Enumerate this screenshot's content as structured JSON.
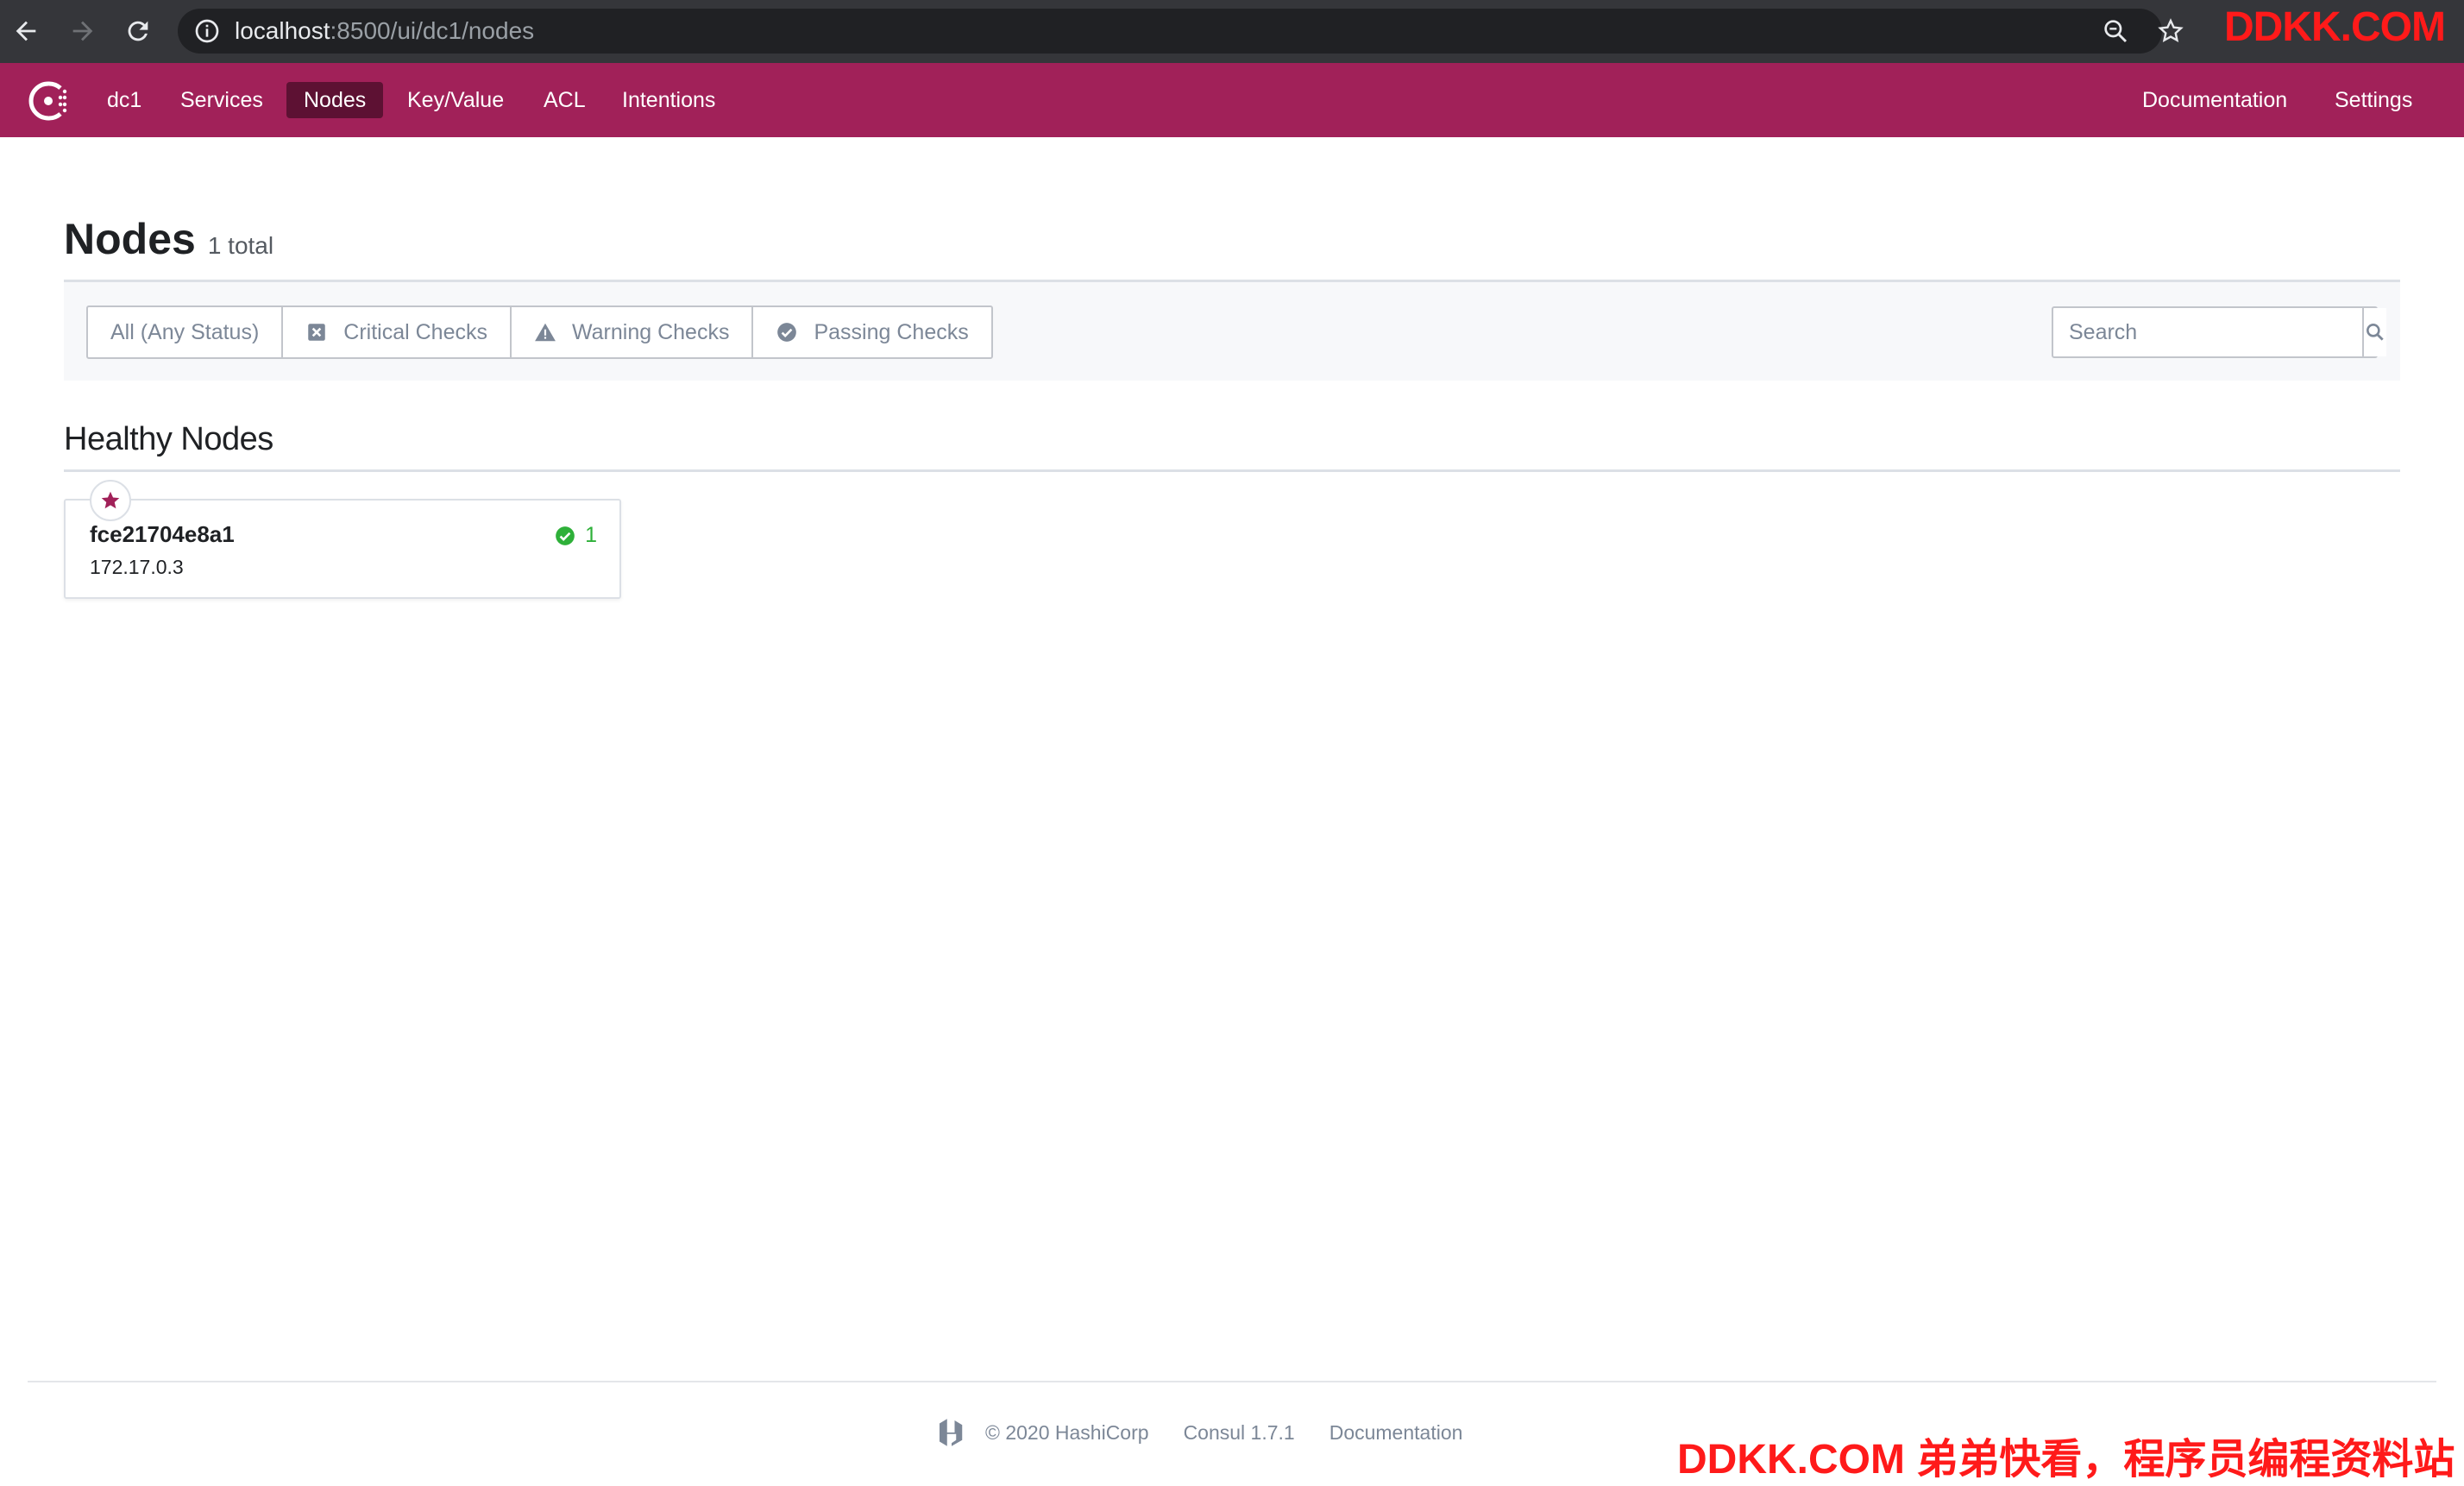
{
  "browser": {
    "url_host": "localhost",
    "url_rest": ":8500/ui/dc1/nodes",
    "watermark": "DDKK.COM"
  },
  "nav": {
    "datacenter": "dc1",
    "items": [
      {
        "label": "Services"
      },
      {
        "label": "Nodes",
        "active": true
      },
      {
        "label": "Key/Value"
      },
      {
        "label": "ACL"
      },
      {
        "label": "Intentions"
      }
    ],
    "documentation": "Documentation",
    "settings": "Settings"
  },
  "page": {
    "title": "Nodes",
    "count": "1 total"
  },
  "filters": {
    "all": "All (Any Status)",
    "critical": "Critical Checks",
    "warning": "Warning Checks",
    "passing": "Passing Checks"
  },
  "search": {
    "placeholder": "Search"
  },
  "section": {
    "title": "Healthy Nodes"
  },
  "nodes": [
    {
      "name": "fce21704e8a1",
      "address": "172.17.0.3",
      "passing": "1"
    }
  ],
  "footer": {
    "copyright": "© 2020 HashiCorp",
    "version": "Consul 1.7.1",
    "documentation": "Documentation"
  },
  "watermark_bottom": "DDKK.COM 弟弟快看，程序员编程资料站",
  "colors": {
    "brand": "#a12159",
    "nav_active": "#5d1133",
    "passing": "#2eb039",
    "muted": "#7c8797"
  }
}
